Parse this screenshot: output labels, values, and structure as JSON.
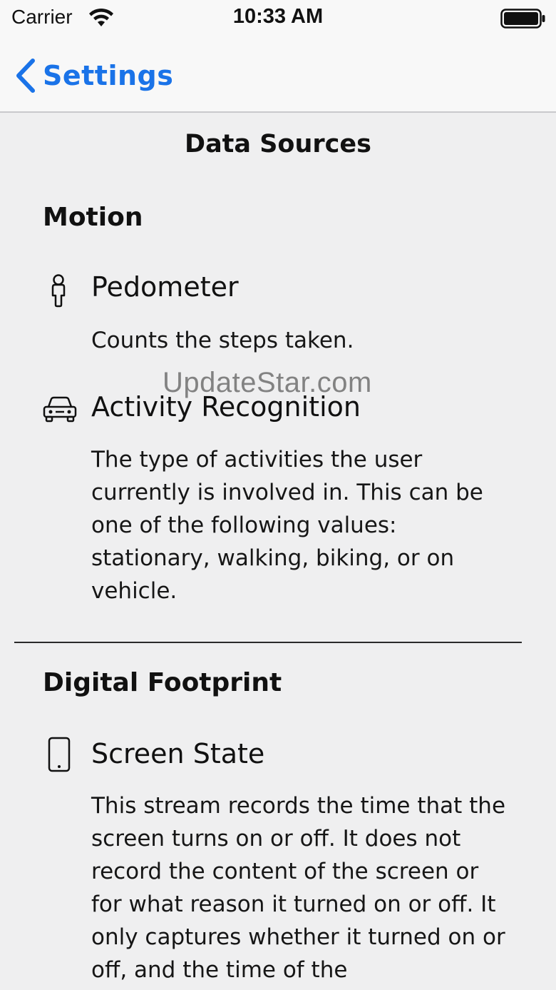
{
  "status_bar": {
    "carrier": "Carrier",
    "time": "10:33 AM",
    "wifi_icon": "wifi-icon",
    "battery_icon": "battery-full-icon"
  },
  "nav": {
    "back_label": "Settings",
    "back_icon": "chevron-left-icon",
    "accent_color": "#1a73e8"
  },
  "page": {
    "title": "Data Sources"
  },
  "sections": [
    {
      "title": "Motion",
      "sources": [
        {
          "icon": "person-icon",
          "name": "Pedometer",
          "description": "Counts the steps taken."
        },
        {
          "icon": "car-icon",
          "name": "Activity Recognition",
          "description": "The type of activities the user currently is involved in. This can be one of the following values: stationary, walking, biking, or on vehicle."
        }
      ]
    },
    {
      "title": "Digital Footprint",
      "sources": [
        {
          "icon": "smartphone-icon",
          "name": "Screen State",
          "description": "This stream records the time that the screen turns on or off. It does not record the content of the screen or for what reason it turned on or off. It only captures whether it turned on or off, and the time of the"
        }
      ]
    }
  ],
  "watermark": "UpdateStar.com"
}
